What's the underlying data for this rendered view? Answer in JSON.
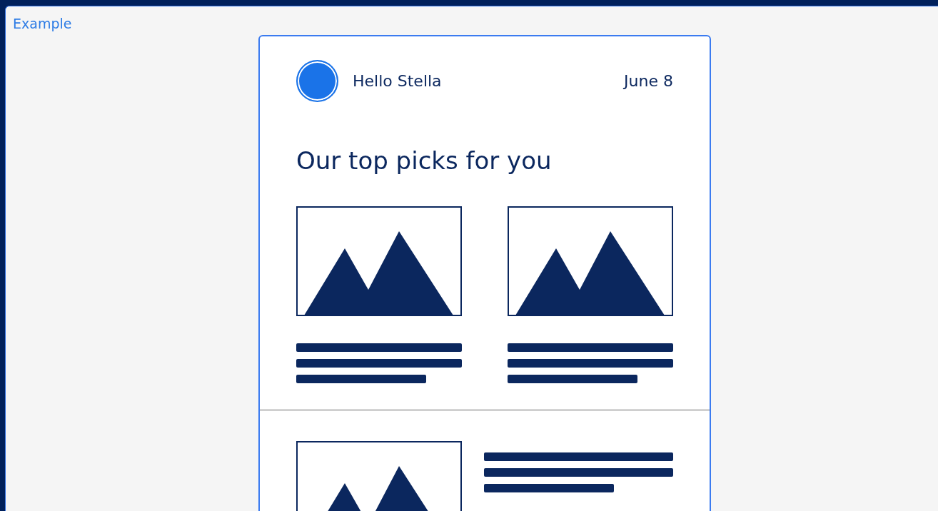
{
  "label": "Example",
  "card": {
    "greeting": "Hello Stella",
    "date": "June 8",
    "heading": "Our top picks for you"
  }
}
